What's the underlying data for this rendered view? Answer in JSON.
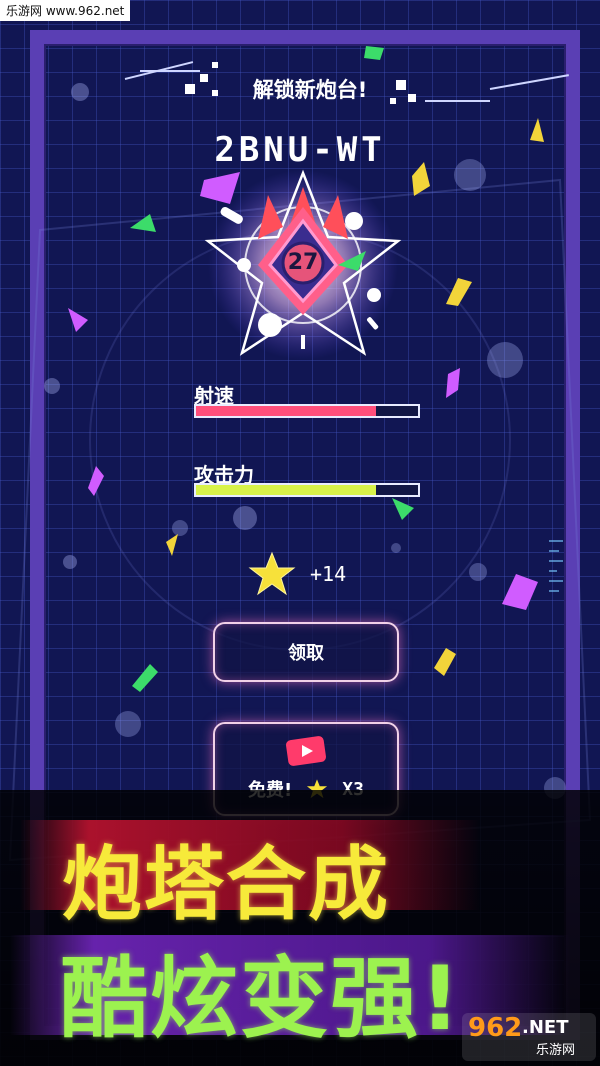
{
  "watermark_top": "乐游网 www.962.net",
  "header": {
    "title": "解锁新炮台!"
  },
  "turret": {
    "name": "2BNU-WT",
    "level": "27"
  },
  "stats": [
    {
      "label": "射速",
      "fraction": 0.81,
      "color": "#ff4f7b"
    },
    {
      "label": "攻击力",
      "fraction": 0.81,
      "color": "#d8f24a"
    }
  ],
  "reward": {
    "icon": "star-icon",
    "count": "+14"
  },
  "buttons": {
    "claim": "领取",
    "ad_free": "免费!",
    "ad_multiplier": "X3",
    "ad_icon": "video-play-icon"
  },
  "promo": {
    "line1": "炮塔合成",
    "line2": "酷炫变强!"
  },
  "watermark_bottom": {
    "brand": "962",
    "net": ".NET",
    "cn": "乐游网"
  },
  "colors": {
    "frame": "#5a3fb4",
    "background": "#111653",
    "promo_line1": "#f7ea3a",
    "promo_line2": "#9cf24f"
  }
}
